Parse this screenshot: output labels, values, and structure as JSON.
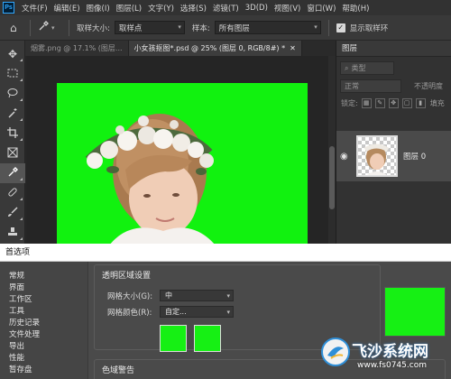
{
  "app": {
    "logo": "Ps",
    "menu": [
      "文件(F)",
      "编辑(E)",
      "图像(I)",
      "图层(L)",
      "文字(Y)",
      "选择(S)",
      "滤镜(T)",
      "3D(D)",
      "视图(V)",
      "窗口(W)",
      "帮助(H)"
    ]
  },
  "options_bar": {
    "sample_size_label": "取样大小:",
    "sample_size_value": "取样点",
    "sample_label": "样本:",
    "sample_value": "所有图层",
    "show_ring_label": "显示取样环",
    "show_ring_checked": true
  },
  "tabs": [
    {
      "label": "烟雾.png @ 17.1% (图层...",
      "active": false
    },
    {
      "label": "小女孩抠图*.psd @ 25% (图层 0, RGB/8#) *",
      "active": true
    }
  ],
  "tools": [
    "move-icon",
    "marquee-icon",
    "lasso-icon",
    "magic-wand-icon",
    "crop-icon",
    "frame-icon",
    "eyedropper-icon",
    "healing-brush-icon",
    "brush-icon",
    "stamp-icon",
    "history-brush-icon"
  ],
  "canvas": {
    "background_color": "#11f20f"
  },
  "layers_panel": {
    "tab": "图层",
    "filter_placeholder": "类型",
    "blend_mode": "正常",
    "opacity_label": "不透明度",
    "lock_label": "锁定:",
    "fill_label": "填充",
    "layer_name": "图层 0"
  },
  "preferences": {
    "title": "首选项",
    "categories": [
      "常规",
      "界面",
      "工作区",
      "工具",
      "历史记录",
      "文件处理",
      "导出",
      "性能",
      "暂存盘"
    ],
    "transparency_group": "透明区域设置",
    "grid_size_label": "网格大小(G):",
    "grid_size_value": "中",
    "grid_color_label": "网格颜色(R):",
    "grid_color_value": "自定...",
    "swatch_color": "#16f014",
    "gamut_group": "色域警告"
  },
  "watermark": {
    "name": "飞沙系统网",
    "url": "www.fs0745.com"
  }
}
